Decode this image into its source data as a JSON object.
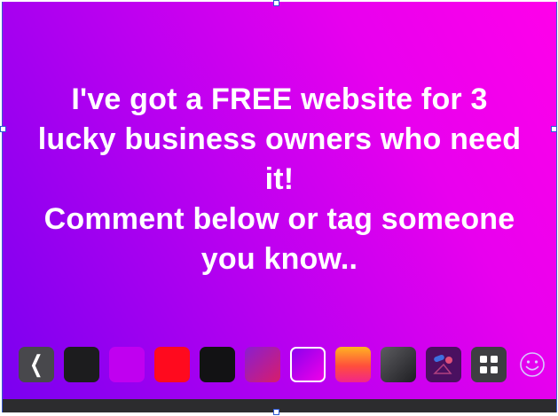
{
  "post": {
    "text": "I've got a FREE website for 3\nlucky business owners who need\nit!\nComment below or tag someone\nyou know.."
  },
  "toolbar": {
    "back_icon": "chevron-left-icon",
    "swatches": [
      {
        "name": "black",
        "fill": "#1c1c1e",
        "selected": false
      },
      {
        "name": "purple",
        "fill": "#c000f0",
        "selected": false
      },
      {
        "name": "red",
        "fill": "#ff0a1e",
        "selected": false
      },
      {
        "name": "dark",
        "fill": "#121214",
        "selected": false
      },
      {
        "name": "purple-red-gradient",
        "fill": "linear-gradient(135deg, #8a1ecf 0%, #d81d6a 100%)",
        "selected": false
      },
      {
        "name": "purple-magenta-gradient",
        "fill": "linear-gradient(135deg, #8c00ee 0%, #ef00e8 100%)",
        "selected": true
      },
      {
        "name": "orange-pink-gradient",
        "fill": "linear-gradient(180deg, #ffb321 0%, #ff4d3d 55%, #f2258a 100%)",
        "selected": false
      },
      {
        "name": "gray-gradient",
        "fill": "linear-gradient(135deg, #5c5c60 0%, #1e1e22 100%)",
        "selected": false
      },
      {
        "name": "shapes-pattern",
        "fill": "#4a1060",
        "selected": false
      }
    ],
    "grid_icon": "grid-icon",
    "emoji_icon": "smiley-icon"
  },
  "colors": {
    "background_start": "#7a00f0",
    "background_end": "#ff00ea",
    "text": "#ffffff",
    "bottom_bar": "#2c2c2e",
    "selection_handle_border": "#2f59d6"
  }
}
